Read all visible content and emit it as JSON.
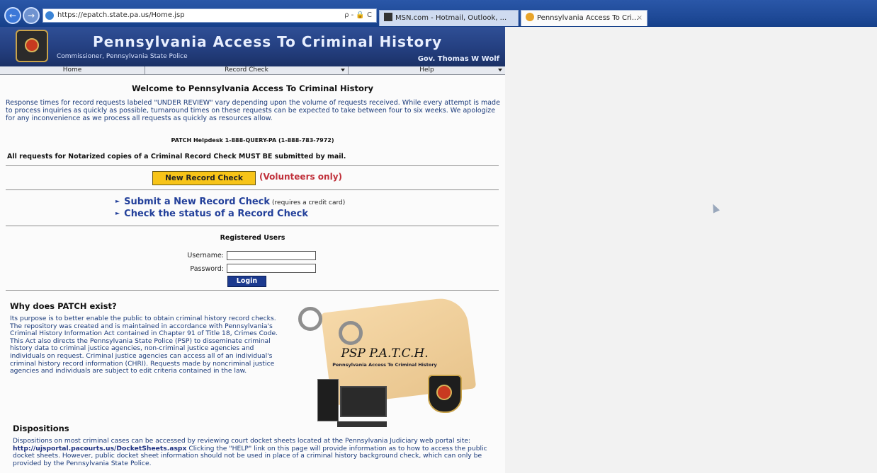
{
  "browser": {
    "url": "https://epatch.state.pa.us/Home.jsp",
    "address_tools": "ρ - 🔒 C",
    "tabs": [
      {
        "label": "MSN.com - Hotmail, Outlook, ..."
      },
      {
        "label": "Pennsylvania Access To Cri...",
        "close": "×"
      }
    ]
  },
  "header": {
    "title": "Pennsylvania Access To Criminal History",
    "commissioner": "Commissioner, Pennsylvania State Police",
    "governor": "Gov. Thomas W Wolf"
  },
  "menu": {
    "items": [
      {
        "label": "Home"
      },
      {
        "label": "Record Check"
      },
      {
        "label": "Help"
      }
    ]
  },
  "welcome": {
    "title": "Welcome to Pennsylvania Access To Criminal History",
    "response_text": "Response times for record requests labeled \"UNDER REVIEW\" vary depending upon the volume of requests received. While every attempt is made to process inquiries as quickly as possible, turnaround times on these requests can be expected to take between four to six weeks. We apologize for any inconvenience as we process all requests as quickly as resources allow.",
    "helpdesk": "PATCH Helpdesk 1-888-QUERY-PA (1-888-783-7972)",
    "notarized": "All requests for Notarized copies of a Criminal Record Check MUST BE submitted by mail."
  },
  "actions": {
    "new_record_button": "New Record Check",
    "volunteers_note": "(Volunteers only)",
    "submit_link": "Submit a New Record Check",
    "submit_note": "(requires a credit card)",
    "status_link": "Check the status of a Record Check",
    "bullet": "►"
  },
  "login": {
    "title": "Registered Users",
    "username_label": "Username:",
    "password_label": "Password:",
    "username_value": "",
    "password_value": "",
    "login_button": "Login"
  },
  "why": {
    "title": "Why does PATCH exist?",
    "text": "Its purpose is to better enable the public to obtain criminal history record checks. The repository was created and is maintained in accordance with Pennsylvania's Criminal History Information Act contained in Chapter 91 of Title 18, Crimes Code. This Act also directs the Pennsylvania State Police (PSP) to disseminate criminal history data to criminal justice agencies, non-criminal justice agencies and individuals on request. Criminal justice agencies can access all of an individual's criminal history record information (CHRI). Requests made by noncriminal justice agencies and individuals are subject to edit criteria contained in the law.",
    "logo_title": "PSP P.A.T.C.H.",
    "logo_subtitle": "Pennsylvania Access To Criminal History"
  },
  "dispositions": {
    "title": "Dispositions",
    "text_before": "Dispositions on most criminal cases can be accessed by reviewing court docket sheets located at the Pennsylvania Judiciary web portal site: ",
    "link": "http://ujsportal.pacourts.us/DocketSheets.aspx",
    "text_after": " Clicking the \"HELP\" link on this page will provide information as to how to access the public docket sheets. However, public docket sheet information should not be used in place of a criminal history background check, which can only be provided by the Pennsylvania State Police."
  }
}
